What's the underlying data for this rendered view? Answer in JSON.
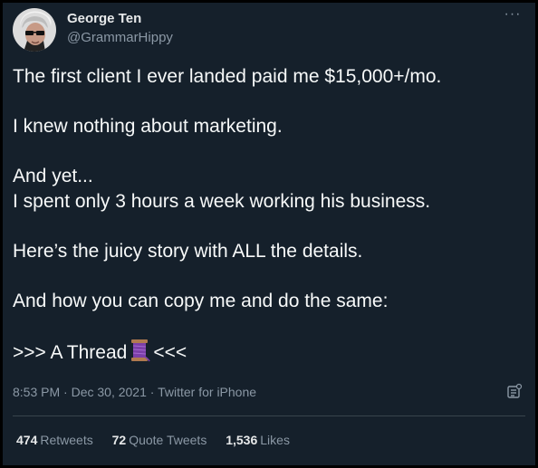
{
  "author": {
    "display_name": "George Ten",
    "handle": "@GrammarHippy"
  },
  "tweet": {
    "lines": [
      "The first client I ever landed paid me $15,000+/mo.",
      "I knew nothing about marketing.",
      "And yet...",
      "I spent only 3 hours a week working his business.",
      "Here’s the juicy story with ALL the details.",
      "And how you can copy me and do the same:",
      ">>> A Thread",
      "<<<"
    ]
  },
  "meta": {
    "time": "8:53 PM",
    "separator": "·",
    "date": "Dec 30, 2021",
    "source": "Twitter for iPhone"
  },
  "stats": {
    "retweets_count": "474",
    "retweets_label": "Retweets",
    "quotes_count": "72",
    "quotes_label": "Quote Tweets",
    "likes_count": "1,536",
    "likes_label": "Likes"
  },
  "icons": {
    "more": "more-horizontal-icon",
    "analytics": "analytics-icon",
    "thread": "spool-of-thread-emoji"
  },
  "colors": {
    "background": "#15202b",
    "text": "#f7f9f9",
    "secondary": "#8b98a5",
    "divider": "#38444d"
  }
}
